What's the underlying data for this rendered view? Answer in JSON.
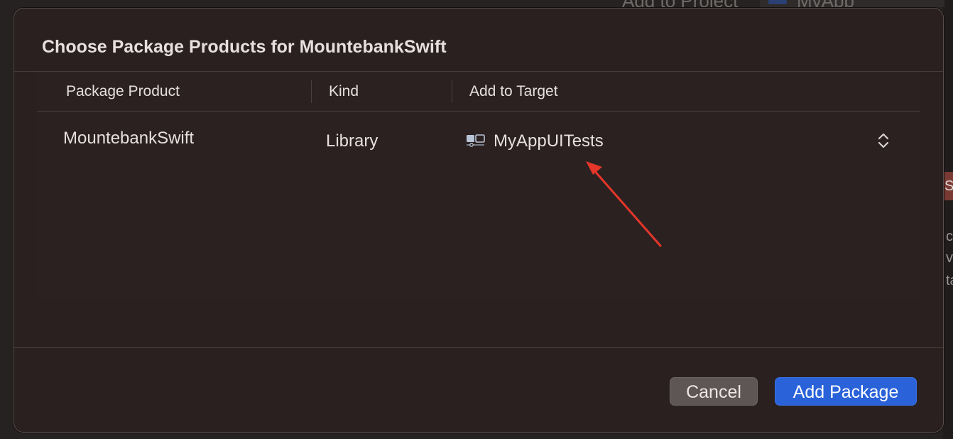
{
  "background": {
    "top_label": "Add to Project",
    "top_app_label": "MyApp",
    "side_tag": "S",
    "side_letters": [
      "c",
      "v",
      "ta"
    ]
  },
  "dialog": {
    "title": "Choose Package Products for MountebankSwift",
    "columns": [
      "Package Product",
      "Kind",
      "Add to Target"
    ],
    "rows": [
      {
        "product": "MountebankSwift",
        "kind": "Library",
        "target": "MyAppUITests",
        "target_icon": "test-target-icon",
        "control_icon": "up-down-chevron-icon"
      }
    ],
    "cancel_label": "Cancel",
    "add_label": "Add Package"
  },
  "annotation": {
    "type": "arrow",
    "color": "#e5362a"
  },
  "colors": {
    "accent": "#2962d9",
    "dialog_background": "#2a201f"
  }
}
